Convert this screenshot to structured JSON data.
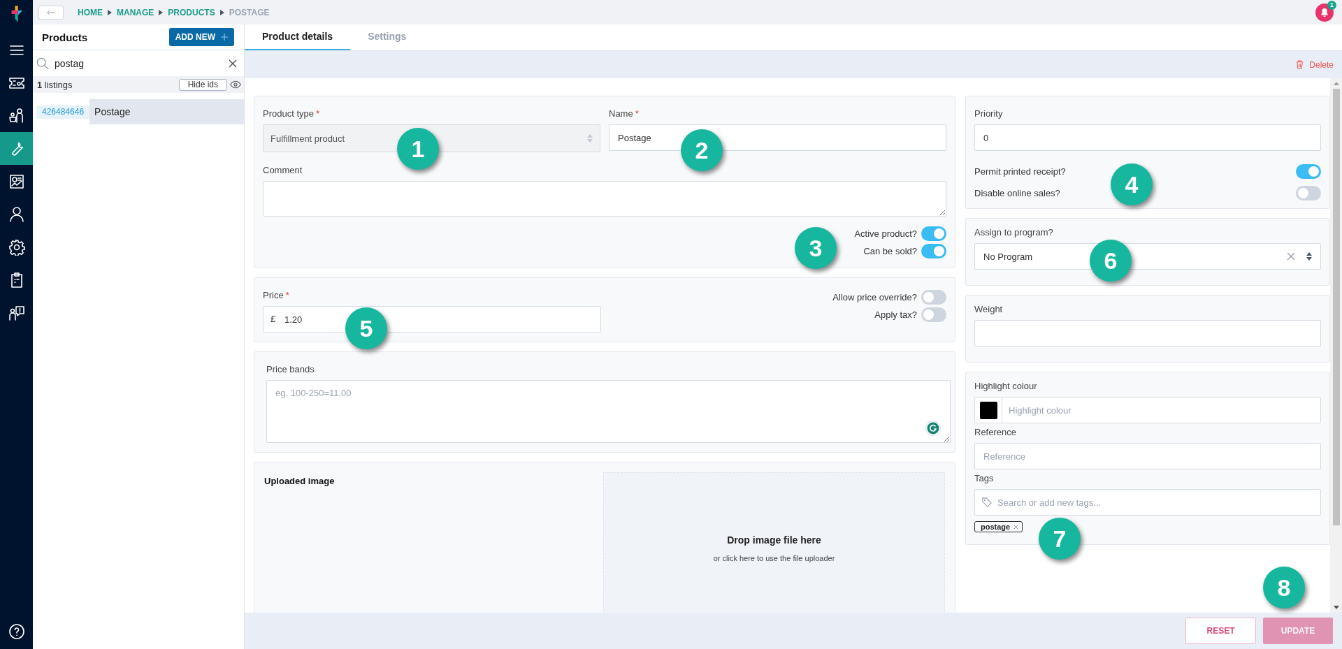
{
  "rail": {
    "items": [
      {
        "kind": "menu",
        "selected": false
      },
      {
        "kind": "ticket",
        "selected": false
      },
      {
        "kind": "people",
        "selected": false
      },
      {
        "kind": "wrench",
        "selected": true
      },
      {
        "kind": "chart",
        "selected": false
      },
      {
        "kind": "user",
        "selected": false
      },
      {
        "kind": "gear",
        "selected": false
      },
      {
        "kind": "clipboard",
        "selected": false
      },
      {
        "kind": "support",
        "selected": false
      }
    ],
    "footer_items": [
      {
        "kind": "help",
        "selected": false
      }
    ]
  },
  "breadcrumb": [
    {
      "label": "HOME",
      "current": false
    },
    {
      "label": "MANAGE",
      "current": false
    },
    {
      "label": "PRODUCTS",
      "current": false
    },
    {
      "label": "POSTAGE",
      "current": true
    }
  ],
  "notifications": {
    "count": "1"
  },
  "products_panel": {
    "title": "Products",
    "add_button": "ADD NEW",
    "search": {
      "value": "postag"
    },
    "listing_count": "1",
    "listing_label": "listings",
    "hide_ids_button": "Hide ids",
    "rows": [
      {
        "id": "426484646",
        "name": "Postage",
        "selected": true
      }
    ]
  },
  "tabs": [
    {
      "label": "Product details",
      "selected": true
    },
    {
      "label": "Settings",
      "selected": false
    }
  ],
  "delete_button": "Delete",
  "form": {
    "product_type": {
      "label": "Product type",
      "required_mark": "*",
      "value": "Fulfillment product",
      "disabled": true
    },
    "name": {
      "label": "Name",
      "required_mark": "*",
      "value": "Postage"
    },
    "comment": {
      "label": "Comment"
    },
    "status_toggles": [
      {
        "label": "Active product?",
        "on": true
      },
      {
        "label": "Can be sold?",
        "on": true
      }
    ],
    "price": {
      "label": "Price",
      "required_mark": "*",
      "currency": "£",
      "value": "1.20"
    },
    "price_toggles": [
      {
        "label": "Allow price override?",
        "on": false
      },
      {
        "label": "Apply tax?",
        "on": false
      }
    ],
    "price_bands": {
      "label": "Price bands",
      "placeholder": "eg. 100-250=11.00"
    },
    "uploaded_image": {
      "label": "Uploaded image",
      "drop_title": "Drop image file here",
      "drop_hint": "or click here to use the file uploader"
    },
    "priority": {
      "label": "Priority",
      "value": "0"
    },
    "receipt_toggles": [
      {
        "label": "Permit printed receipt?",
        "on": true
      },
      {
        "label": "Disable online sales?",
        "on": false
      }
    ],
    "program": {
      "label": "Assign to program?",
      "value": "No Program"
    },
    "weight": {
      "label": "Weight"
    },
    "highlight_colour": {
      "label": "Highlight colour",
      "placeholder": "Highlight colour",
      "color": "#000000"
    },
    "reference": {
      "label": "Reference",
      "placeholder": "Reference"
    },
    "tags": {
      "label": "Tags",
      "placeholder": "Search or add new tags...",
      "items": [
        "postage"
      ]
    }
  },
  "footer_buttons": [
    {
      "label": "RESET",
      "kind": "outline",
      "disabled": true
    },
    {
      "label": "UPDATE",
      "kind": "filled",
      "disabled": true
    }
  ],
  "annotations": [
    {
      "label": "1"
    },
    {
      "label": "2"
    },
    {
      "label": "3"
    },
    {
      "label": "4"
    },
    {
      "label": "5"
    },
    {
      "label": "6"
    },
    {
      "label": "7"
    },
    {
      "label": "8"
    }
  ]
}
